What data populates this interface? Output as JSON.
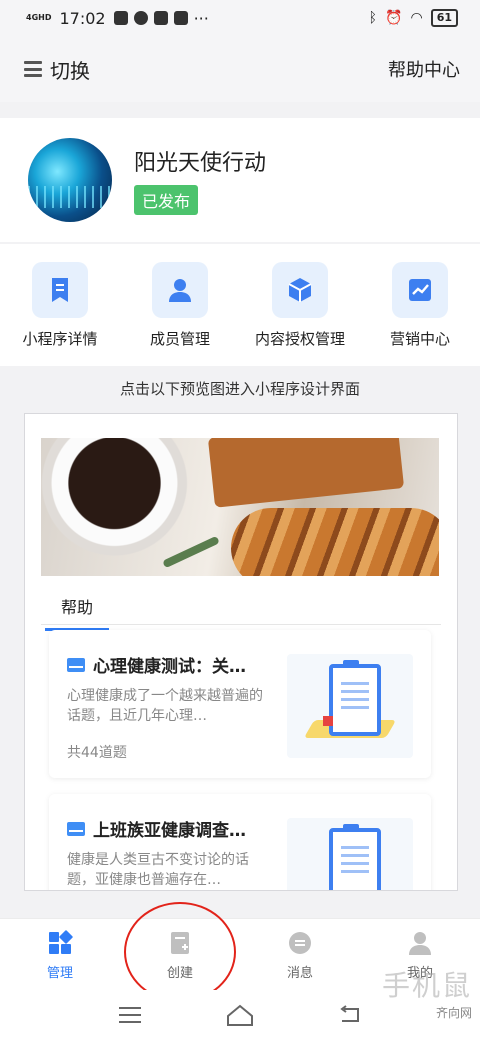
{
  "status": {
    "time": "17:02",
    "network": "4GHD",
    "battery": "61"
  },
  "header": {
    "switch_label": "切换",
    "help_label": "帮助中心"
  },
  "profile": {
    "name": "阳光天使行动",
    "status_badge": "已发布"
  },
  "quick_actions": [
    {
      "label": "小程序详情",
      "icon": "bookmark-icon"
    },
    {
      "label": "成员管理",
      "icon": "person-icon"
    },
    {
      "label": "内容授权管理",
      "icon": "cube-icon"
    },
    {
      "label": "营销中心",
      "icon": "trend-chart-icon"
    }
  ],
  "preview": {
    "hint": "点击以下预览图进入小程序设计界面",
    "tab_label": "帮助",
    "cards": [
      {
        "title": "心理健康测试：关…",
        "desc": "心理健康成了一个越来越普遍的话题，且近几年心理…",
        "meta": "共44道题"
      },
      {
        "title": "上班族亚健康调查…",
        "desc": "健康是人类亘古不变讨论的话题，亚健康也普遍存在…",
        "meta": ""
      }
    ]
  },
  "tabbar": [
    {
      "label": "管理",
      "icon": "grid-icon",
      "active": true
    },
    {
      "label": "创建",
      "icon": "create-doc-icon",
      "active": false
    },
    {
      "label": "消息",
      "icon": "message-icon",
      "active": false
    },
    {
      "label": "我的",
      "icon": "user-icon",
      "active": false
    }
  ],
  "watermark": {
    "main": "手机鼠",
    "sub": "齐向网"
  },
  "colors": {
    "accent": "#2f7cf6",
    "published": "#4cc36d",
    "annotation_circle": "#e2231a"
  }
}
